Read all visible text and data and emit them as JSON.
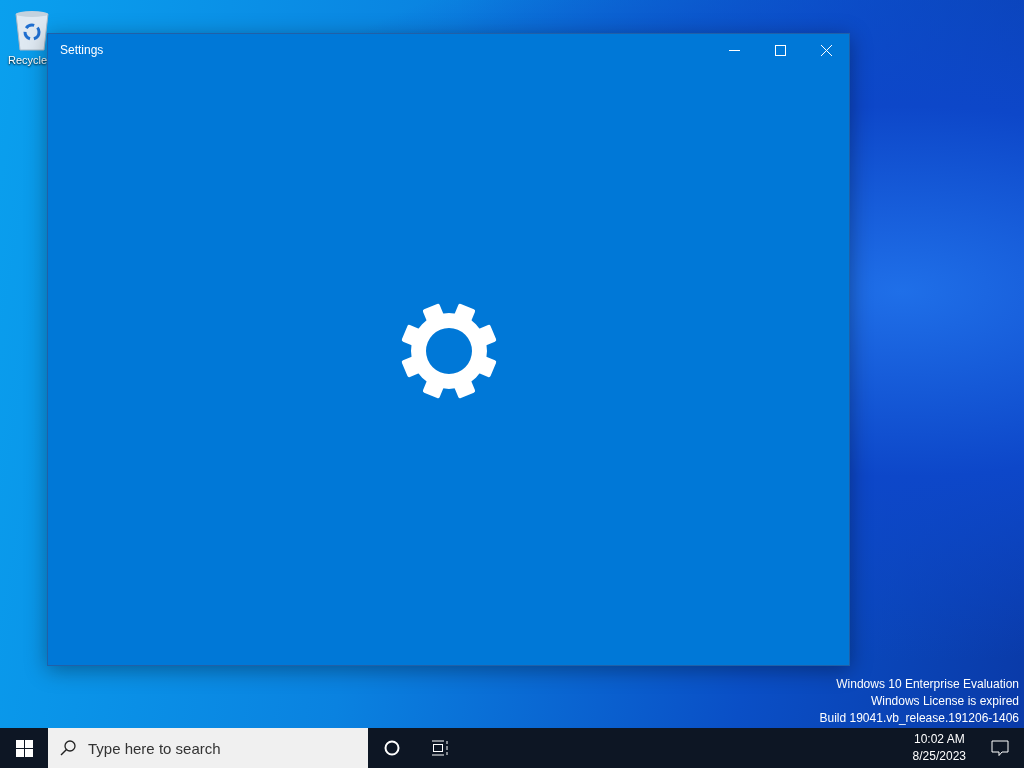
{
  "desktop": {
    "icons": [
      {
        "label": "Recycle"
      }
    ],
    "watermark": [
      "Windows 10 Enterprise Evaluation",
      "Windows License is expired",
      "Build 19041.vb_release.191206-1406"
    ]
  },
  "window": {
    "title": "Settings"
  },
  "taskbar": {
    "search": {
      "placeholder": "Type here to search"
    },
    "time": "10:02 AM",
    "date": "8/25/2023"
  }
}
